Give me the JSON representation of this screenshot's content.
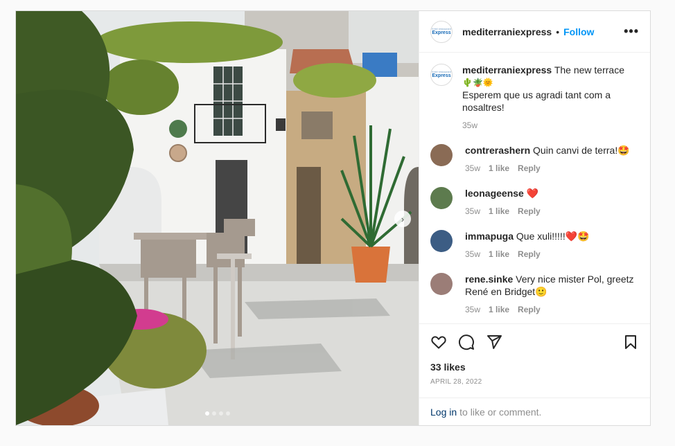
{
  "post": {
    "username": "mediterraniexpress",
    "separator": "•",
    "follow_label": "Follow",
    "more_label": "•••",
    "logo_small": "hotel restaurant",
    "logo_big": "Express",
    "caption": {
      "username": "mediterraniexpress",
      "line1": "The new terrace",
      "emojis": "🌵🪴🌞",
      "line2": "Esperem que us agradi tant com a nosaltres!",
      "time": "35w"
    },
    "comments": [
      {
        "username": "contrerashern",
        "text": "Quin canvi de terra!🤩",
        "time": "35w",
        "likes": "1 like",
        "reply": "Reply",
        "avatar_color": "#8a6b55"
      },
      {
        "username": "leonageense",
        "text": "❤️",
        "time": "35w",
        "likes": "1 like",
        "reply": "Reply",
        "avatar_color": "#5d7b4e"
      },
      {
        "username": "immapuga",
        "text": "Que xuli!!!!!❤️🤩",
        "time": "35w",
        "likes": "1 like",
        "reply": "Reply",
        "avatar_color": "#3c5d84"
      },
      {
        "username": "rene.sinke",
        "text": "Very nice mister Pol, greetz René en Bridget🙂",
        "time": "35w",
        "likes": "1 like",
        "reply": "Reply",
        "avatar_color": "#9b7d77"
      }
    ],
    "likes": "33 likes",
    "date": "APRIL 28, 2022",
    "login_link": "Log in",
    "login_text": "to like or comment."
  },
  "carousel": {
    "next_label": "›",
    "total": 4,
    "current": 1
  },
  "colors": {
    "accent": "#0095f6",
    "text": "#262626",
    "muted": "#8e8e8e"
  }
}
